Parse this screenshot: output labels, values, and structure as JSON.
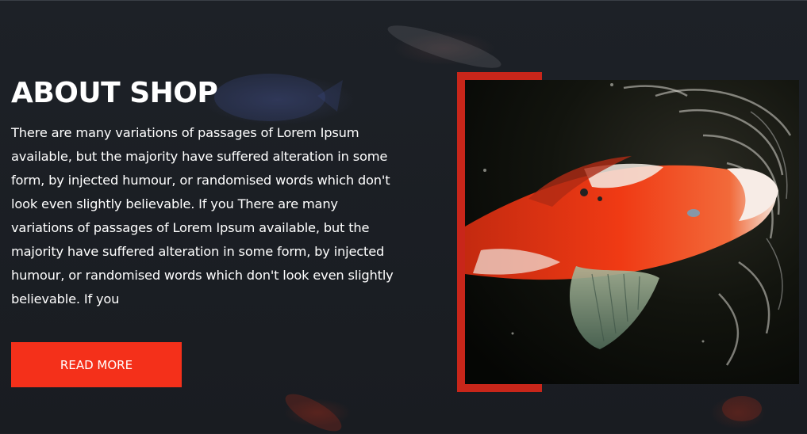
{
  "about": {
    "title": "ABOUT SHOP",
    "body": "There are many variations of passages of Lorem Ipsum available, but the majority have suffered alteration in some form, by injected humour, or randomised words which don't look even slightly believable. If you There are many variations of passages of Lorem Ipsum available, but the majority have suffered alteration in some form, by injected humour, or randomised words which don't look even slightly believable. If you",
    "button_label": "READ MORE"
  },
  "colors": {
    "accent": "#f4301a",
    "frame": "#c8261a",
    "background": "#1c1f24"
  },
  "image": {
    "subject": "koi-fish-photo"
  }
}
